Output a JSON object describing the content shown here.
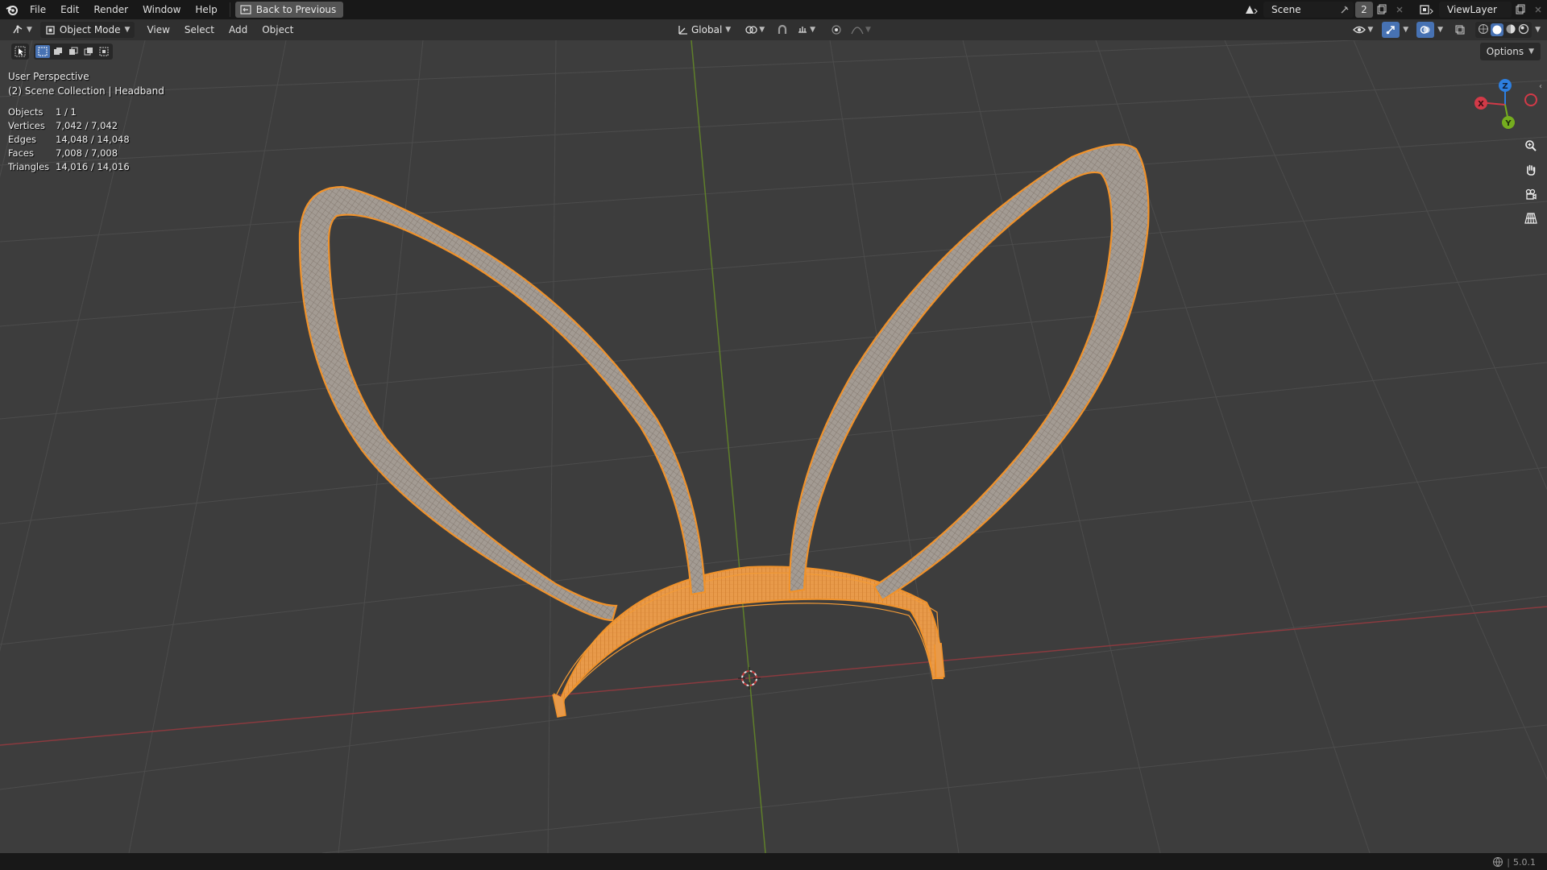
{
  "topbar": {
    "menus": [
      "File",
      "Edit",
      "Render",
      "Window",
      "Help"
    ],
    "back_button": "Back to Previous",
    "scene_label": "Scene",
    "scene_count": "2",
    "view_layer": "ViewLayer"
  },
  "header": {
    "mode": "Object Mode",
    "menus": [
      "View",
      "Select",
      "Add",
      "Object"
    ],
    "transform_orientation": "Global",
    "options_label": "Options"
  },
  "overlay": {
    "perspective": "User Perspective",
    "collection": "(2) Scene Collection | Headband"
  },
  "stats": [
    {
      "label": "Objects",
      "value": "1 / 1"
    },
    {
      "label": "Vertices",
      "value": "7,042 / 7,042"
    },
    {
      "label": "Edges",
      "value": "14,048 / 14,048"
    },
    {
      "label": "Faces",
      "value": "7,008 / 7,008"
    },
    {
      "label": "Triangles",
      "value": "14,016 / 14,016"
    }
  ],
  "gizmo": {
    "x_label": "X",
    "y_label": "Y",
    "z_label": "Z"
  },
  "status": {
    "version": "5.0.1"
  },
  "colors": {
    "selection_orange": "#f0922b",
    "x_axis": "#d23a48",
    "y_axis": "#75ad1f",
    "z_axis": "#2d7fe0",
    "accent_blue": "#4772b3"
  },
  "icons": [
    "blender-logo",
    "back-icon",
    "scene-icon",
    "pin-icon",
    "new-scene-icon",
    "viewlayer-icon",
    "editor-type-icon",
    "object-mode-icon",
    "transform-orientation-icon",
    "pivot-icon",
    "snap-icon",
    "proportional-icon",
    "visibility-icon",
    "gizmo-icon",
    "overlay-icon",
    "xray-icon",
    "wireframe-shading-icon",
    "solid-shading-icon",
    "material-shading-icon",
    "rendered-shading-icon",
    "zoom-icon",
    "pan-icon",
    "camera-icon",
    "grid-icon",
    "select-tool-icon",
    "cursor-3d-icon"
  ]
}
